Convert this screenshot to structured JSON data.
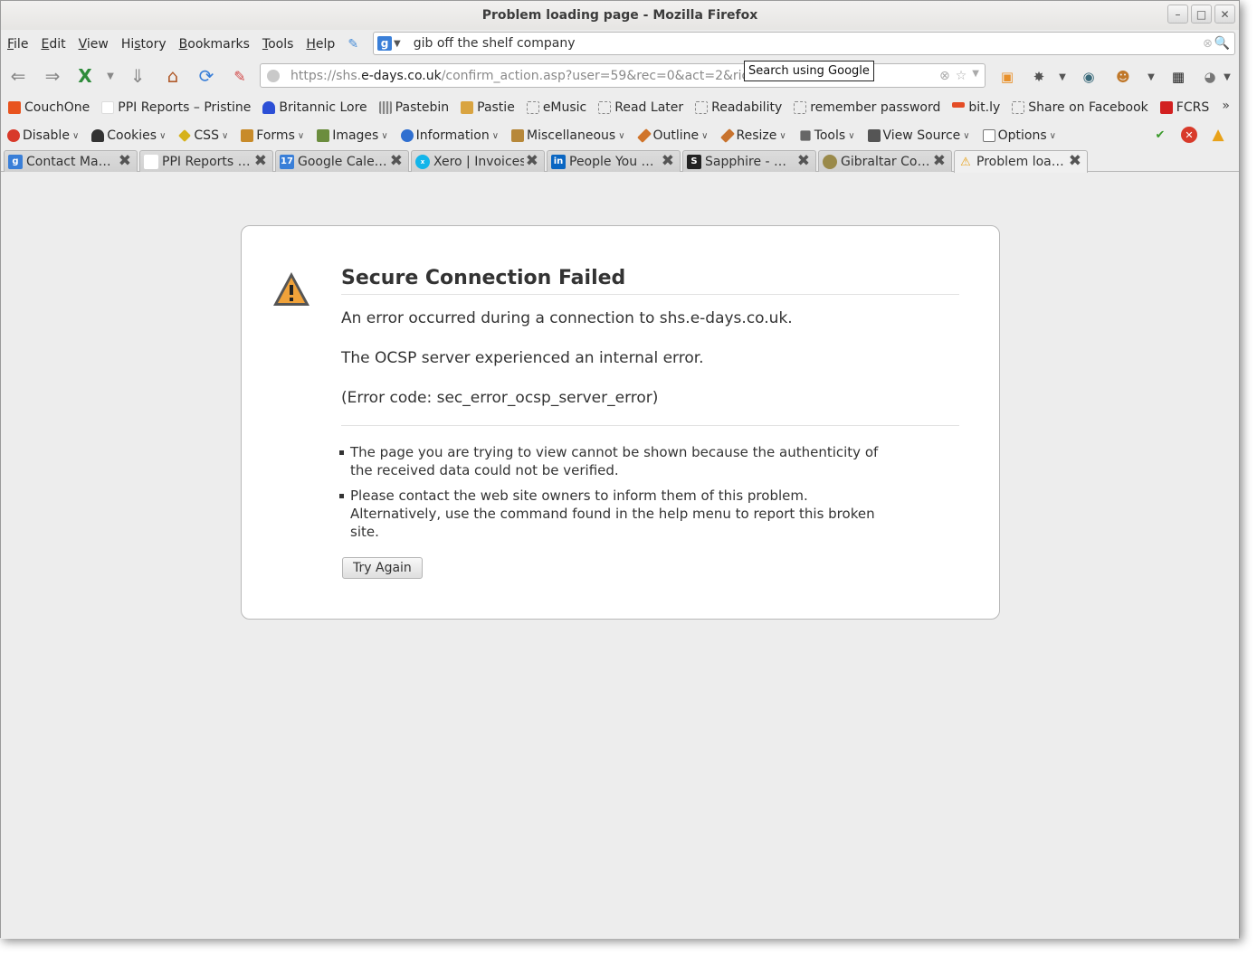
{
  "window": {
    "title": "Problem loading page - Mozilla Firefox"
  },
  "menu": [
    {
      "label": "File",
      "key": "F",
      "rest": "ile"
    },
    {
      "label": "Edit",
      "key": "E",
      "rest": "dit"
    },
    {
      "label": "View",
      "key": "V",
      "rest": "iew"
    },
    {
      "label": "History",
      "key": "",
      "pre": "Hi",
      "ukey": "s",
      "rest": "tory"
    },
    {
      "label": "Bookmarks",
      "key": "B",
      "rest": "ookmarks"
    },
    {
      "label": "Tools",
      "key": "T",
      "rest": "ools"
    },
    {
      "label": "Help",
      "key": "H",
      "rest": "elp"
    }
  ],
  "search": {
    "value": "gib off the shelf company",
    "engine_icon": "google-icon",
    "tooltip": "Search using Google"
  },
  "url": {
    "scheme_prefix": "https://shs.",
    "host": "e-days.co.uk",
    "path": "/confirm_action.asp?user=59&rec=0&act=2&rid=427"
  },
  "bookmarks": [
    {
      "label": "CouchOne",
      "icon": "couchone-icon",
      "color": "#e8531e"
    },
    {
      "label": "PPI Reports – Pristine",
      "icon": "page-icon",
      "color": "#ffffff"
    },
    {
      "label": "Britannic Lore",
      "icon": "ship-icon",
      "color": "#2c4fd6"
    },
    {
      "label": "Pastebin",
      "icon": "pastebin-icon",
      "color": "#888888"
    },
    {
      "label": "Pastie",
      "icon": "pastie-icon",
      "color": "#d9a441"
    },
    {
      "label": "eMusic",
      "icon": "bookmarklet-icon",
      "color": ""
    },
    {
      "label": "Read Later",
      "icon": "bookmarklet-icon",
      "color": ""
    },
    {
      "label": "Readability",
      "icon": "bookmarklet-icon",
      "color": ""
    },
    {
      "label": "remember password",
      "icon": "bookmarklet-icon",
      "color": ""
    },
    {
      "label": "bit.ly",
      "icon": "bitly-icon",
      "color": "#e44d26"
    },
    {
      "label": "Share on Facebook",
      "icon": "bookmarklet-icon",
      "color": ""
    },
    {
      "label": "FCRS",
      "icon": "fcrs-icon",
      "color": "#d22020"
    }
  ],
  "devtools": [
    {
      "label": "Disable",
      "icon": "disable-icon",
      "color": "#d83a2a"
    },
    {
      "label": "Cookies",
      "icon": "cookies-icon",
      "color": "#333333"
    },
    {
      "label": "CSS",
      "icon": "css-icon",
      "color": "#d6b21c"
    },
    {
      "label": "Forms",
      "icon": "forms-icon",
      "color": "#c88b2a"
    },
    {
      "label": "Images",
      "icon": "images-icon",
      "color": "#6b8d3e"
    },
    {
      "label": "Information",
      "icon": "information-icon",
      "color": "#2f6fd0"
    },
    {
      "label": "Miscellaneous",
      "icon": "miscellaneous-icon",
      "color": "#b7883a"
    },
    {
      "label": "Outline",
      "icon": "outline-icon",
      "color": "#d0742a"
    },
    {
      "label": "Resize",
      "icon": "resize-icon",
      "color": "#c8732e"
    },
    {
      "label": "Tools",
      "icon": "tools-icon",
      "color": "#666666"
    },
    {
      "label": "View Source",
      "icon": "view-source-icon",
      "color": "#555555"
    },
    {
      "label": "Options",
      "icon": "options-icon",
      "color": "#777777"
    }
  ],
  "tabs": [
    {
      "label": "Contact Ma…",
      "icon": "google-icon",
      "color": "#3a7fd8",
      "active": false
    },
    {
      "label": "PPI Reports …",
      "icon": "page-icon",
      "color": "#ffffff",
      "active": false
    },
    {
      "label": "Google Cale…",
      "icon": "calendar-icon",
      "color": "#3a7fd8",
      "active": false
    },
    {
      "label": "Xero | Invoices",
      "icon": "xero-icon",
      "color": "#13b5ea",
      "active": false
    },
    {
      "label": "People You …",
      "icon": "linkedin-icon",
      "color": "#0a66c2",
      "active": false
    },
    {
      "label": "Sapphire - …",
      "icon": "sapphire-icon",
      "color": "#222222",
      "active": false
    },
    {
      "label": "Gibraltar Co…",
      "icon": "gibraltar-icon",
      "color": "#9a8a4a",
      "active": false
    },
    {
      "label": "Problem loa…",
      "icon": "warning-icon",
      "color": "#f2c200",
      "active": true
    }
  ],
  "error": {
    "title": "Secure Connection Failed",
    "line1": "An error occurred during a connection to shs.e-days.co.uk.",
    "line2": "The OCSP server experienced an internal error.",
    "line3": "(Error code: sec_error_ocsp_server_error)",
    "bullets": [
      "The page you are trying to view cannot be shown because the authenticity of the received data could not be verified.",
      "Please contact the web site owners to inform them of this problem. Alternatively, use the command found in the help menu to report this broken site."
    ],
    "button": "Try Again"
  }
}
